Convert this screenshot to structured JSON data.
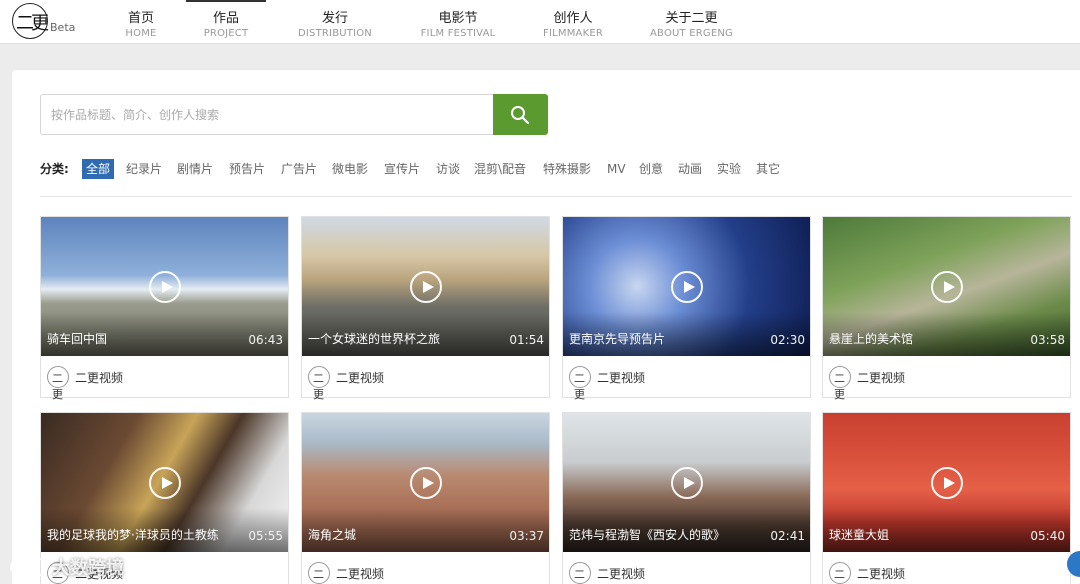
{
  "logo": {
    "beta": "Beta"
  },
  "nav": [
    {
      "zh": "首页",
      "en": "HOME"
    },
    {
      "zh": "作品",
      "en": "PROJECT"
    },
    {
      "zh": "发行",
      "en": "DISTRIBUTION"
    },
    {
      "zh": "电影节",
      "en": "FILM FESTIVAL"
    },
    {
      "zh": "创作人",
      "en": "FILMMAKER"
    },
    {
      "zh": "关于二更",
      "en": "ABOUT ERGENG"
    }
  ],
  "search": {
    "placeholder": "按作品标题、简介、创作人搜索"
  },
  "categories": {
    "label": "分类:",
    "items": [
      "全部",
      "纪录片",
      "剧情片",
      "预告片",
      "广告片",
      "微电影",
      "宣传片",
      "访谈",
      "混剪\\配音",
      "特殊摄影",
      "MV",
      "创意",
      "动画",
      "实验",
      "其它"
    ]
  },
  "videos": [
    {
      "title": "骑车回中国",
      "duration": "06:43",
      "author": "二更视频"
    },
    {
      "title": "一个女球迷的世界杯之旅",
      "duration": "01:54",
      "author": "二更视频"
    },
    {
      "title": "更南京先导预告片",
      "duration": "02:30",
      "author": "二更视频"
    },
    {
      "title": "悬崖上的美术馆",
      "duration": "03:58",
      "author": "二更视频"
    },
    {
      "title": "我的足球我的梦·洋球员的土教练",
      "duration": "05:55",
      "author": "二更视频"
    },
    {
      "title": "海角之城",
      "duration": "03:37",
      "author": "二更视频"
    },
    {
      "title": "范炜与程渤智《西安人的歌》",
      "duration": "02:41",
      "author": "二更视频"
    },
    {
      "title": "球迷童大姐",
      "duration": "05:40",
      "author": "二更视频"
    }
  ],
  "watermark": "大数跨境",
  "colors": {
    "accent_green": "#5a9a2e",
    "accent_blue": "#2f6bb3"
  }
}
